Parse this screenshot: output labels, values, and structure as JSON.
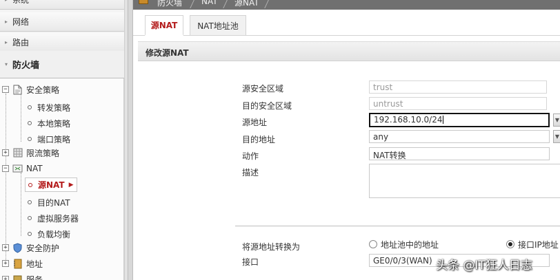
{
  "sidebar": {
    "menu": [
      {
        "label": "系统"
      },
      {
        "label": "网络"
      },
      {
        "label": "路由"
      },
      {
        "label": "防火墙"
      }
    ],
    "tree": [
      {
        "label": "安全策略"
      },
      {
        "label": "转发策略"
      },
      {
        "label": "本地策略"
      },
      {
        "label": "端口策略"
      },
      {
        "label": "限流策略"
      },
      {
        "label": "NAT"
      },
      {
        "label": "源NAT"
      },
      {
        "label": "目的NAT"
      },
      {
        "label": "虚拟服务器"
      },
      {
        "label": "负载均衡"
      },
      {
        "label": "安全防护"
      },
      {
        "label": "地址"
      },
      {
        "label": "服务"
      }
    ]
  },
  "breadcrumb": [
    "防火墙",
    "NAT",
    "源NAT"
  ],
  "tabs": [
    {
      "label": "源NAT",
      "active": true
    },
    {
      "label": "NAT地址池",
      "active": false
    }
  ],
  "section_title": "修改源NAT",
  "form": {
    "src_zone": {
      "label": "源安全区域",
      "value": "trust"
    },
    "dst_zone": {
      "label": "目的安全区域",
      "value": "untrust"
    },
    "src_addr": {
      "label": "源地址",
      "value": "192.168.10.0/24"
    },
    "dst_addr": {
      "label": "目的地址",
      "value": "any"
    },
    "action": {
      "label": "动作",
      "value": "NAT转换"
    },
    "description": {
      "label": "描述",
      "value": ""
    },
    "translate": {
      "label": "将源地址转换为",
      "option_pool": "地址池中的地址",
      "option_iface": "接口IP地址",
      "selected": "option_iface"
    },
    "interface": {
      "label": "接口",
      "value": "GE0/0/3(WAN)"
    }
  },
  "watermark": "头条 @IT狂人日志",
  "colors": {
    "accent": "#b31b1b",
    "breadcrumb_bg": "#707070"
  }
}
